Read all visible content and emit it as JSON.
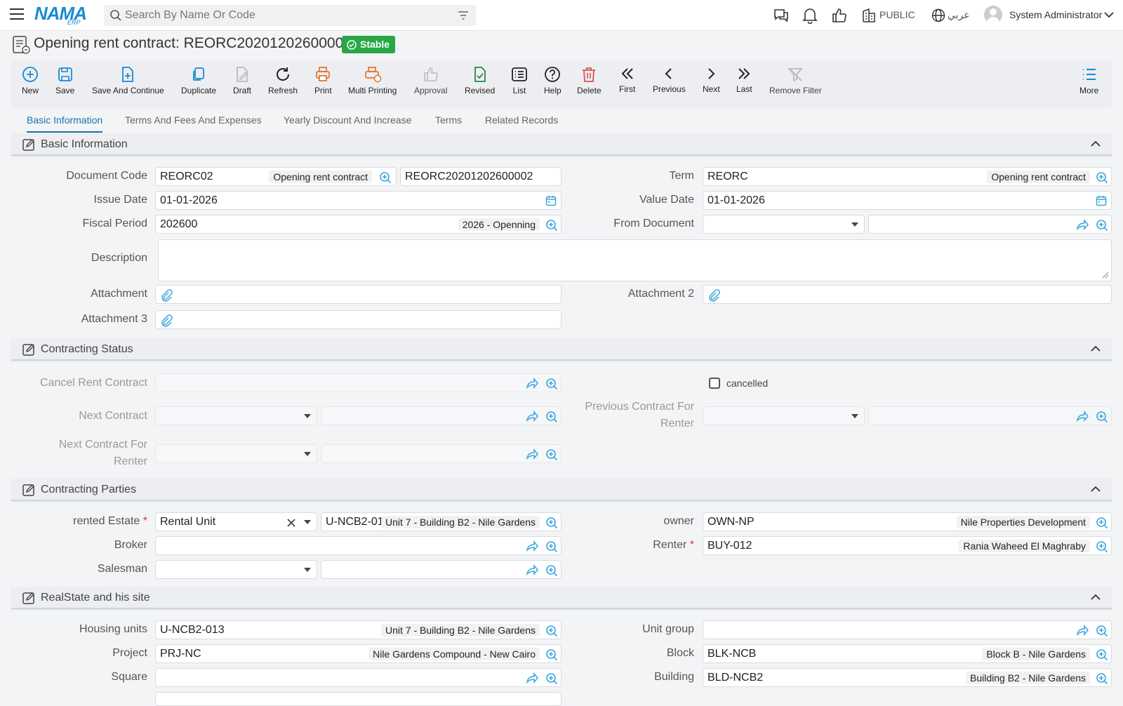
{
  "header": {
    "logo": "NAMA",
    "logo_sub": "ERP",
    "search_placeholder": "Search By Name Or Code",
    "public_label": "PUBLIC",
    "language_label": "عربي",
    "user_name": "System Administrator"
  },
  "page": {
    "title": "Opening rent contract: REORC20201202600002",
    "status": "Stable"
  },
  "toolbar": {
    "new": "New",
    "save": "Save",
    "save_continue": "Save And Continue",
    "duplicate": "Duplicate",
    "draft": "Draft",
    "refresh": "Refresh",
    "print": "Print",
    "multi_printing": "Multi Printing",
    "approval": "Approval",
    "revised": "Revised",
    "list": "List",
    "help": "Help",
    "delete": "Delete",
    "first": "First",
    "previous": "Previous",
    "next": "Next",
    "last": "Last",
    "remove_filter": "Remove Filter",
    "more": "More"
  },
  "tabs": [
    "Basic Information",
    "Terms And Fees And Expenses",
    "Yearly Discount And Increase",
    "Terms",
    "Related Records"
  ],
  "sections": {
    "basic": "Basic Information",
    "status": "Contracting Status",
    "parties": "Contracting Parties",
    "realstate": "RealState and his site"
  },
  "basic": {
    "document_code_label": "Document Code",
    "document_code": "REORC02",
    "document_code_tag": "Opening rent contract",
    "document_number": "REORC20201202600002",
    "term_label": "Term",
    "term": "REORC",
    "term_tag": "Opening rent contract",
    "issue_date_label": "Issue Date",
    "issue_date": "01-01-2026",
    "value_date_label": "Value Date",
    "value_date": "01-01-2026",
    "fiscal_period_label": "Fiscal Period",
    "fiscal_period": "202600",
    "fiscal_period_tag": "2026 - Openning",
    "from_document_label": "From Document",
    "description_label": "Description",
    "attachment_label": "Attachment",
    "attachment2_label": "Attachment 2",
    "attachment3_label": "Attachment 3"
  },
  "status": {
    "cancel_label": "Cancel Rent Contract",
    "cancelled_label": "cancelled",
    "next_contract_label": "Next Contract",
    "prev_contract_renter_label": "Previous Contract For Renter",
    "next_contract_renter_label": "Next Contract For Renter"
  },
  "parties": {
    "rented_estate_label": "rented Estate",
    "rented_estate": "Rental Unit",
    "rented_estate_code": "U-NCB2-01",
    "rented_estate_tag": "Unit 7 - Building B2 - Nile Gardens",
    "owner_label": "owner",
    "owner": "OWN-NP",
    "owner_tag": "Nile Properties Development",
    "broker_label": "Broker",
    "renter_label": "Renter",
    "renter": "BUY-012",
    "renter_tag": "Rania Waheed El Maghraby",
    "salesman_label": "Salesman"
  },
  "realstate": {
    "housing_units_label": "Housing units",
    "housing_units": "U-NCB2-013",
    "housing_units_tag": "Unit 7 - Building B2 - Nile Gardens",
    "unit_group_label": "Unit group",
    "project_label": "Project",
    "project": "PRJ-NC",
    "project_tag": "Nile Gardens Compound - New Cairo",
    "block_label": "Block",
    "block": "BLK-NCB",
    "block_tag": "Block B - Nile Gardens",
    "square_label": "Square",
    "building_label": "Building",
    "building": "BLD-NCB2",
    "building_tag": "Building B2 - Nile Gardens"
  },
  "colors": {
    "accent": "#1a8ad4",
    "status_green": "#27a745",
    "print_orange": "#e8762c",
    "delete_red": "#d9534f",
    "revised_green": "#2e8b3a"
  }
}
